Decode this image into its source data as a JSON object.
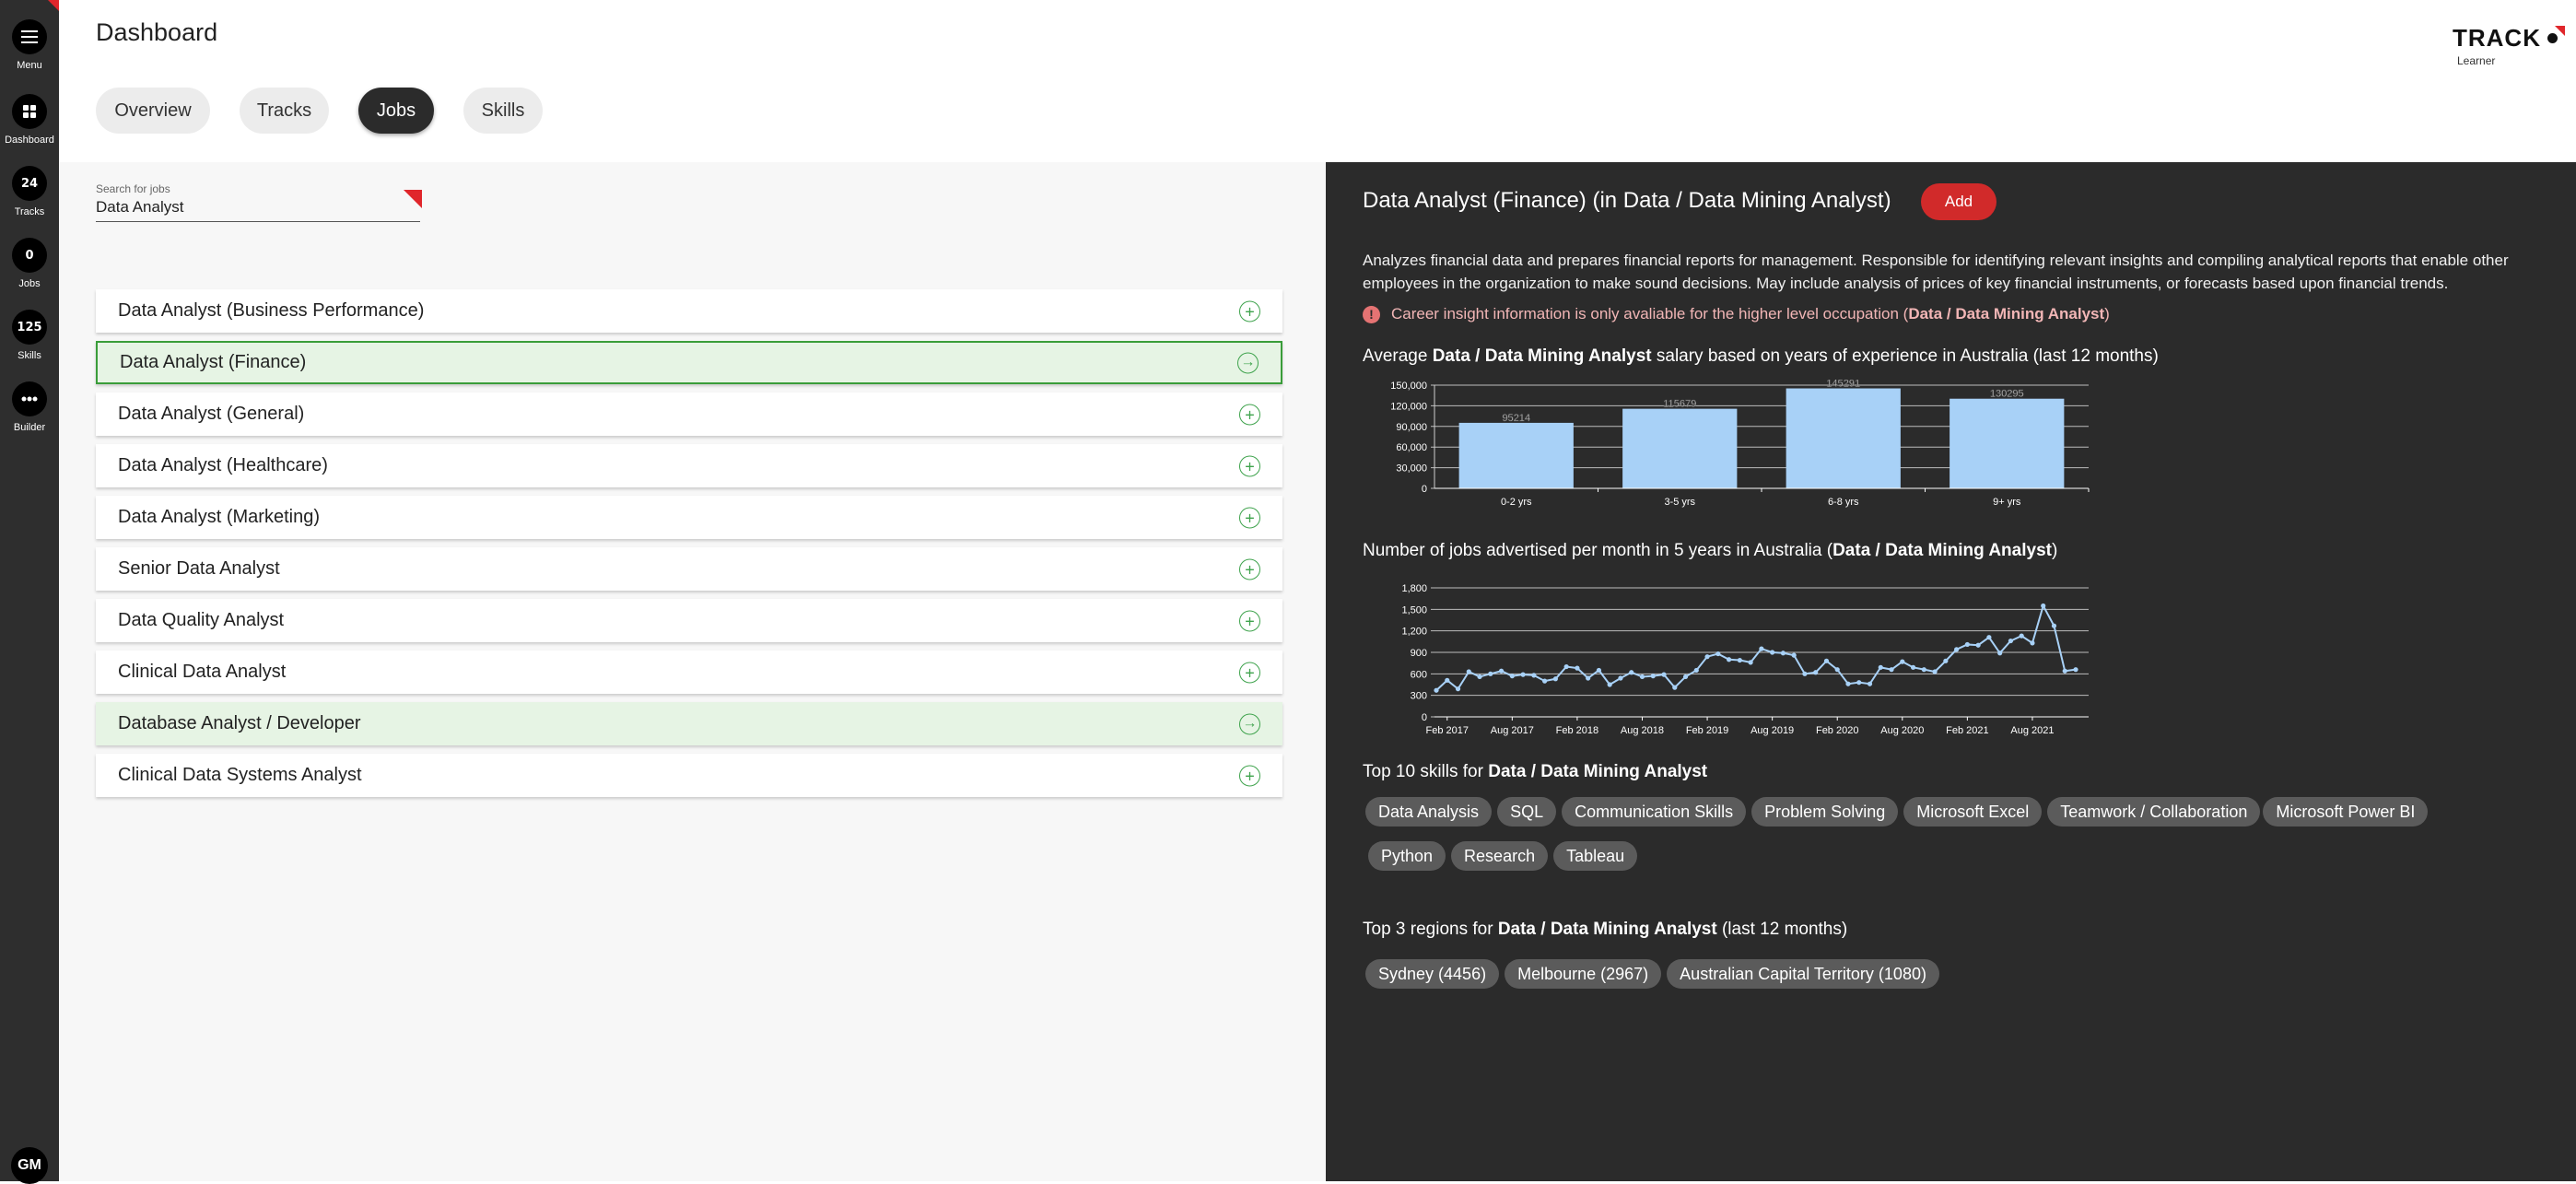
{
  "rail": {
    "menu_label": "Menu",
    "dashboard_label": "Dashboard",
    "tracks_count": "24",
    "tracks_label": "Tracks",
    "jobs_count": "0",
    "jobs_label": "Jobs",
    "skills_count": "125",
    "skills_label": "Skills",
    "builder_label": "Builder",
    "avatar_initials": "GM",
    "accent_color": "#e0262b"
  },
  "header": {
    "title": "Dashboard",
    "logo_text": "TRACK",
    "logo_subtext": "Learner"
  },
  "tabs": [
    {
      "label": "Overview",
      "active": false
    },
    {
      "label": "Tracks",
      "active": false
    },
    {
      "label": "Jobs",
      "active": true
    },
    {
      "label": "Skills",
      "active": false
    }
  ],
  "search": {
    "label": "Search for jobs",
    "value": "Data Analyst"
  },
  "jobs": [
    {
      "label": "Data Analyst (Business Performance)",
      "state": "normal",
      "icon": "plus-circle"
    },
    {
      "label": "Data Analyst (Finance)",
      "state": "selected",
      "icon": "arrow-circle"
    },
    {
      "label": "Data Analyst (General)",
      "state": "normal",
      "icon": "plus-circle"
    },
    {
      "label": "Data Analyst (Healthcare)",
      "state": "normal",
      "icon": "plus-circle"
    },
    {
      "label": "Data Analyst (Marketing)",
      "state": "normal",
      "icon": "plus-circle"
    },
    {
      "label": "Senior Data Analyst",
      "state": "normal",
      "icon": "plus-circle"
    },
    {
      "label": "Data Quality Analyst",
      "state": "normal",
      "icon": "plus-circle"
    },
    {
      "label": "Clinical Data Analyst",
      "state": "normal",
      "icon": "plus-circle"
    },
    {
      "label": "Database Analyst / Developer",
      "state": "highlight",
      "icon": "arrow-circle"
    },
    {
      "label": "Clinical Data Systems Analyst",
      "state": "normal",
      "icon": "plus-circle"
    }
  ],
  "detail": {
    "title": "Data Analyst (Finance) (in Data / Data Mining Analyst)",
    "add_label": "Add",
    "description": "Analyzes financial data and prepares financial reports for management. Responsible for identifying relevant insights and compiling analytical reports that enable other employees in the organization to make sound decisions. May include analysis of prices of key financial instruments, or forecasts based upon financial trends.",
    "notice_prefix": "Career insight information is only avaliable for the higher level occupation (",
    "notice_occupation": "Data / Data Mining Analyst",
    "notice_suffix": ")",
    "occupation": "Data / Data Mining Analyst",
    "salary_prefix": "Average ",
    "salary_suffix": " salary based on years of experience in Australia (last 12 months)",
    "jobs_prefix": "Number of jobs advertised per month in 5 years in Australia (",
    "jobs_suffix": ")",
    "skills_prefix": "Top 10 skills for ",
    "regions_prefix": "Top 3 regions for ",
    "regions_suffix": " (last 12 months)",
    "skills": [
      "Data Analysis",
      "SQL",
      "Communication Skills",
      "Problem Solving",
      "Microsoft Excel",
      "Teamwork / Collaboration",
      "Microsoft Power BI",
      "Python",
      "Research",
      "Tableau"
    ],
    "regions": [
      "Sydney (4456)",
      "Melbourne (2967)",
      "Australian Capital Territory (1080)"
    ]
  },
  "chart_data": [
    {
      "type": "bar",
      "categories": [
        "0-2 yrs",
        "3-5 yrs",
        "6-8 yrs",
        "9+ yrs"
      ],
      "values": [
        95214,
        115679,
        145291,
        130295
      ],
      "data_labels": [
        "95214",
        "115679",
        "145291",
        "130295"
      ],
      "ylim": [
        0,
        150000
      ],
      "yticks": [
        "0",
        "30,000",
        "60,000",
        "90,000",
        "120,000",
        "150,000"
      ],
      "bar_color": "#a8d1f7",
      "grid": true
    },
    {
      "type": "line",
      "x_tick_labels": [
        "Feb 2017",
        "Aug 2017",
        "Feb 2018",
        "Aug 2018",
        "Feb 2019",
        "Aug 2019",
        "Feb 2020",
        "Aug 2020",
        "Feb 2021",
        "Aug 2021"
      ],
      "x_start": "Jan 2017",
      "values": [
        370,
        510,
        390,
        630,
        560,
        600,
        640,
        570,
        590,
        580,
        500,
        530,
        700,
        680,
        540,
        650,
        450,
        540,
        620,
        560,
        570,
        590,
        410,
        560,
        650,
        840,
        880,
        800,
        790,
        760,
        950,
        900,
        890,
        860,
        600,
        620,
        780,
        660,
        460,
        480,
        460,
        690,
        660,
        770,
        690,
        660,
        630,
        780,
        940,
        1010,
        1000,
        1110,
        890,
        1060,
        1130,
        1030,
        1550,
        1270,
        640,
        660
      ],
      "ylim": [
        0,
        1800
      ],
      "yticks": [
        "0",
        "300",
        "600",
        "900",
        "1,200",
        "1,500",
        "1,800"
      ],
      "line_color": "#a8d1f7",
      "grid": true
    }
  ]
}
